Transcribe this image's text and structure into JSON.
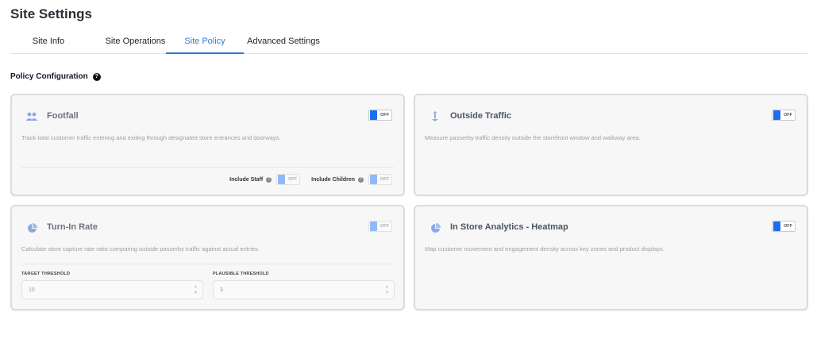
{
  "page": {
    "title": "Site Settings"
  },
  "tabs": [
    {
      "label": "Site Info",
      "active": false
    },
    {
      "label": "Site Operations",
      "active": false
    },
    {
      "label": "Site Policy",
      "active": true
    },
    {
      "label": "Advanced Settings",
      "active": false
    }
  ],
  "section": {
    "title": "Policy Configuration",
    "help_icon": "question-circle-icon"
  },
  "toggle_off_label": "OFF",
  "colors": {
    "accent": "#2f7bd8",
    "toggle_knob": "#1a6ef5"
  },
  "cards": {
    "footfall": {
      "title": "Footfall",
      "icon": "users-icon",
      "description": "Track total customer traffic entering and exiting through designated store entrances and doorways.",
      "toggle": "OFF",
      "options": [
        {
          "label": "Include Staff",
          "toggle": "OFF"
        },
        {
          "label": "Include Children",
          "toggle": "OFF"
        }
      ]
    },
    "outside_traffic": {
      "title": "Outside Traffic",
      "icon": "person-walking-icon",
      "description": "Measure passerby traffic density outside the storefront window and walkway area.",
      "toggle": "OFF"
    },
    "turn_in_rate": {
      "title": "Turn-In Rate",
      "icon": "pie-chart-icon",
      "description": "Calculate store capture rate ratio comparing outside passerby traffic against actual entries.",
      "toggle": "OFF",
      "target_label": "TARGET THRESHOLD",
      "target_value": "10",
      "plausible_label": "PLAUSIBLE THRESHOLD",
      "plausible_value": "3"
    },
    "heatmap": {
      "title": "In Store Analytics - Heatmap",
      "icon": "pie-chart-icon",
      "description": "Map customer movement and engagement density across key zones and product displays.",
      "toggle": "OFF"
    }
  }
}
